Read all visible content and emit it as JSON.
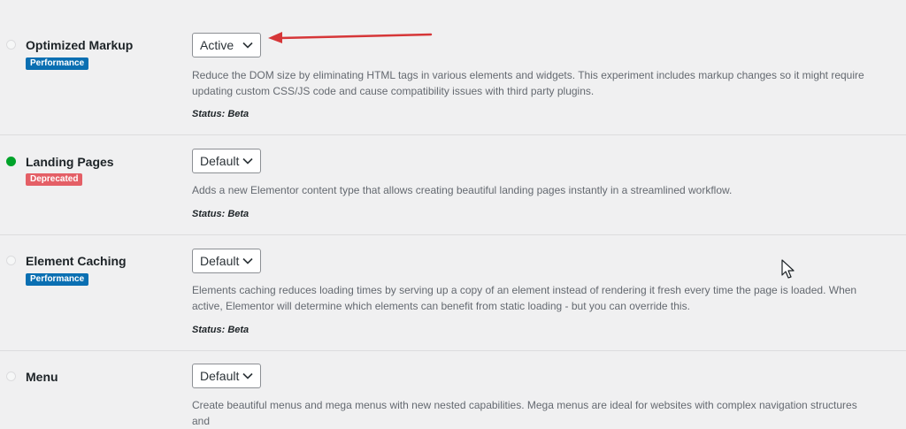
{
  "experiments": [
    {
      "title": "Optimized Markup",
      "tag": "Performance",
      "select_value": "Active",
      "description": "Reduce the DOM size by eliminating HTML tags in various elements and widgets. This experiment includes markup changes so it might require updating custom CSS/JS code and cause compatibility issues with third party plugins.",
      "status": "Status: Beta",
      "indicator": "inactive"
    },
    {
      "title": "Landing Pages",
      "tag": "Deprecated",
      "select_value": "Default",
      "description": "Adds a new Elementor content type that allows creating beautiful landing pages instantly in a streamlined workflow.",
      "status": "Status: Beta",
      "indicator": "active"
    },
    {
      "title": "Element Caching",
      "tag": "Performance",
      "select_value": "Default",
      "description": "Elements caching reduces loading times by serving up a copy of an element instead of rendering it fresh every time the page is loaded. When active, Elementor will determine which elements can benefit from static loading - but you can override this.",
      "status": "Status: Beta",
      "indicator": "inactive"
    },
    {
      "title": "Menu",
      "select_value": "Default",
      "description": "Create beautiful menus and mega menus with new nested capabilities. Mega menus are ideal for websites with complex navigation structures and",
      "indicator": "inactive"
    }
  ],
  "colors": {
    "performance_tag": "#0a6fb2",
    "deprecated_tag": "#e45f66",
    "active_indicator": "#00a32a",
    "annotation_arrow": "#d63638"
  },
  "icons": [
    "chevron-down-icon",
    "annotation-arrow-icon",
    "mouse-cursor-icon"
  ]
}
